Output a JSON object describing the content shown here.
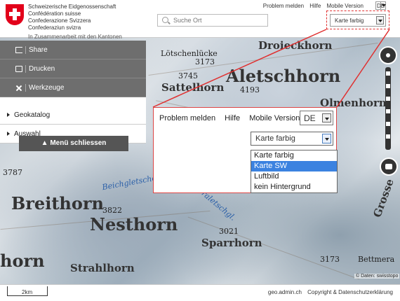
{
  "header": {
    "confederation": [
      "Schweizerische Eidgenossenschaft",
      "Confédération suisse",
      "Confederazione Svizzera",
      "Confederaziun svizra"
    ],
    "cantons_note": "In Zusammenarbeit mit den Kantonen",
    "search_placeholder": "Suche Ort",
    "links": [
      "Problem melden",
      "Hilfe",
      "Mobile Version"
    ],
    "language": "DE",
    "background_select": "Karte farbig"
  },
  "sidebar": {
    "tools": [
      {
        "label": "Share",
        "icon": "share-icon"
      },
      {
        "label": "Drucken",
        "icon": "print-icon"
      },
      {
        "label": "Werkzeuge",
        "icon": "tools-icon"
      }
    ],
    "sections": [
      "Geokatalog",
      "Auswahl"
    ],
    "close_menu": "Menü schliessen"
  },
  "zoom_panel": {
    "links": [
      "Problem melden",
      "Hilfe",
      "Mobile Version"
    ],
    "language": "DE",
    "selected_background": "Karte farbig",
    "options": [
      "Karte farbig",
      "Karte SW",
      "Luftbild",
      "kein Hintergrund"
    ],
    "highlighted_option": "Karte SW"
  },
  "map": {
    "labels": {
      "droieckhorn": "Droieckhorn",
      "lotschenlucke": "Lötschenlücke",
      "h3173": "3173",
      "h3745": "3745",
      "sattelhorn": "Sattelhorn",
      "aletschhorn": "Aletschhorn",
      "h4193": "4193",
      "olmenhorn": "Olmenhorn",
      "h3787": "3787",
      "beichgletscher": "Beichgletscher",
      "oberaletschgl": "Oberaletschgl.",
      "breithorn": "Breithorn",
      "h3822": "3822",
      "nesthorn": "Nesthorn",
      "sparrhorn": "Sparrhorn",
      "horn": "horn",
      "strahlhorn": "Strahlhorn",
      "h3021": "3021",
      "grosse": "Grosse",
      "bettmera": "Bettmera",
      "h3173b": "3173"
    },
    "credit": "© Daten: swisstopo"
  },
  "footer": {
    "scale": "2km",
    "links": [
      "geo.admin.ch",
      "Copyright & Datenschutzerklärung"
    ]
  },
  "colors": {
    "swiss_red": "#e2001a",
    "sidebar_grey": "#6e6e6e",
    "highlight_blue": "#3b82e0",
    "callout_red": "#e03030"
  }
}
